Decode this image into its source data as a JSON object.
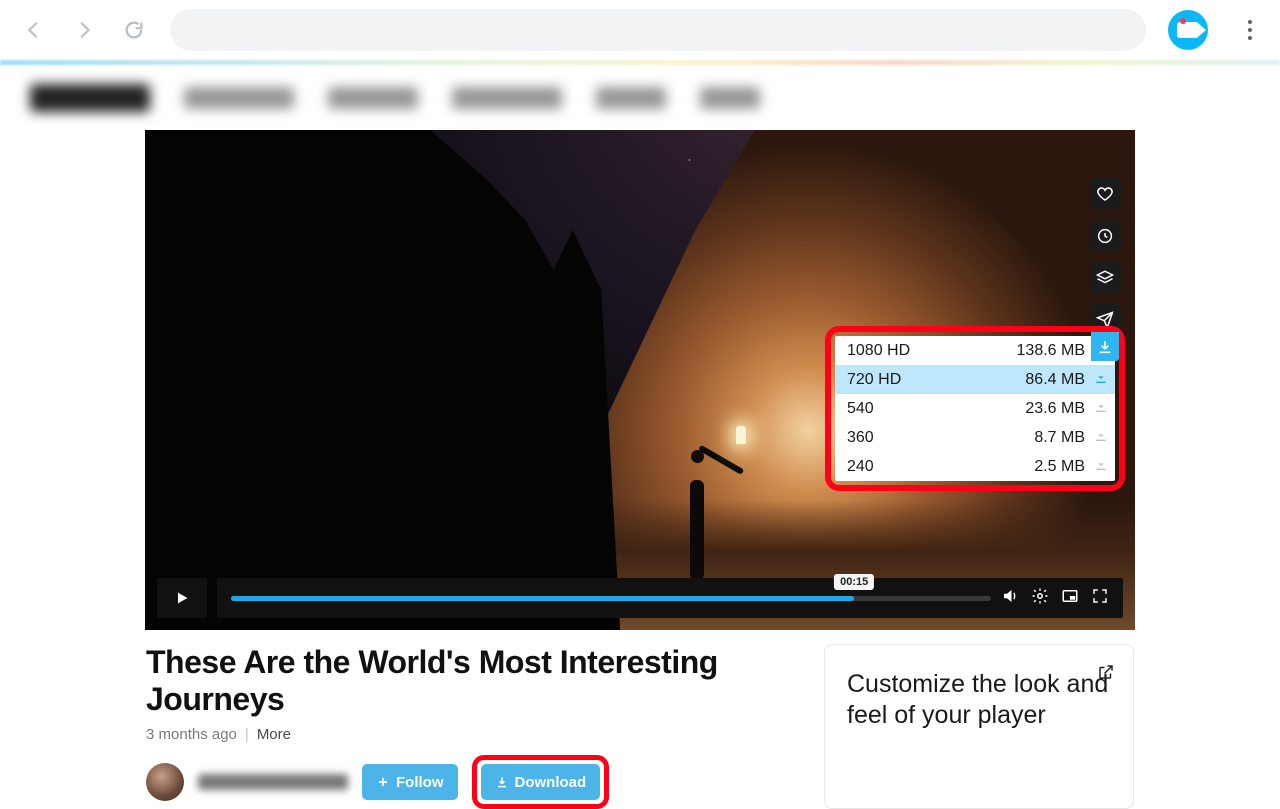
{
  "browser": {
    "back": "",
    "forward": "",
    "reload": ""
  },
  "video": {
    "title": "These Are the World's Most Interesting Journeys",
    "posted": "3 months ago",
    "more": "More",
    "time_tip": "00:15"
  },
  "actions": {
    "follow": "Follow",
    "download": "Download"
  },
  "rail": {
    "heart": "heart-icon",
    "clock": "clock-icon",
    "layers": "layers-icon",
    "share": "share-icon"
  },
  "download_menu": {
    "button": "download-arrow",
    "options": [
      {
        "quality": "1080 HD",
        "size": "138.6 MB",
        "active": false
      },
      {
        "quality": "720 HD",
        "size": "86.4 MB",
        "active": true
      },
      {
        "quality": "540",
        "size": "23.6 MB",
        "active": false
      },
      {
        "quality": "360",
        "size": "8.7 MB",
        "active": false
      },
      {
        "quality": "240",
        "size": "2.5 MB",
        "active": false
      }
    ]
  },
  "promo": {
    "text": "Customize the look and feel of your player"
  }
}
